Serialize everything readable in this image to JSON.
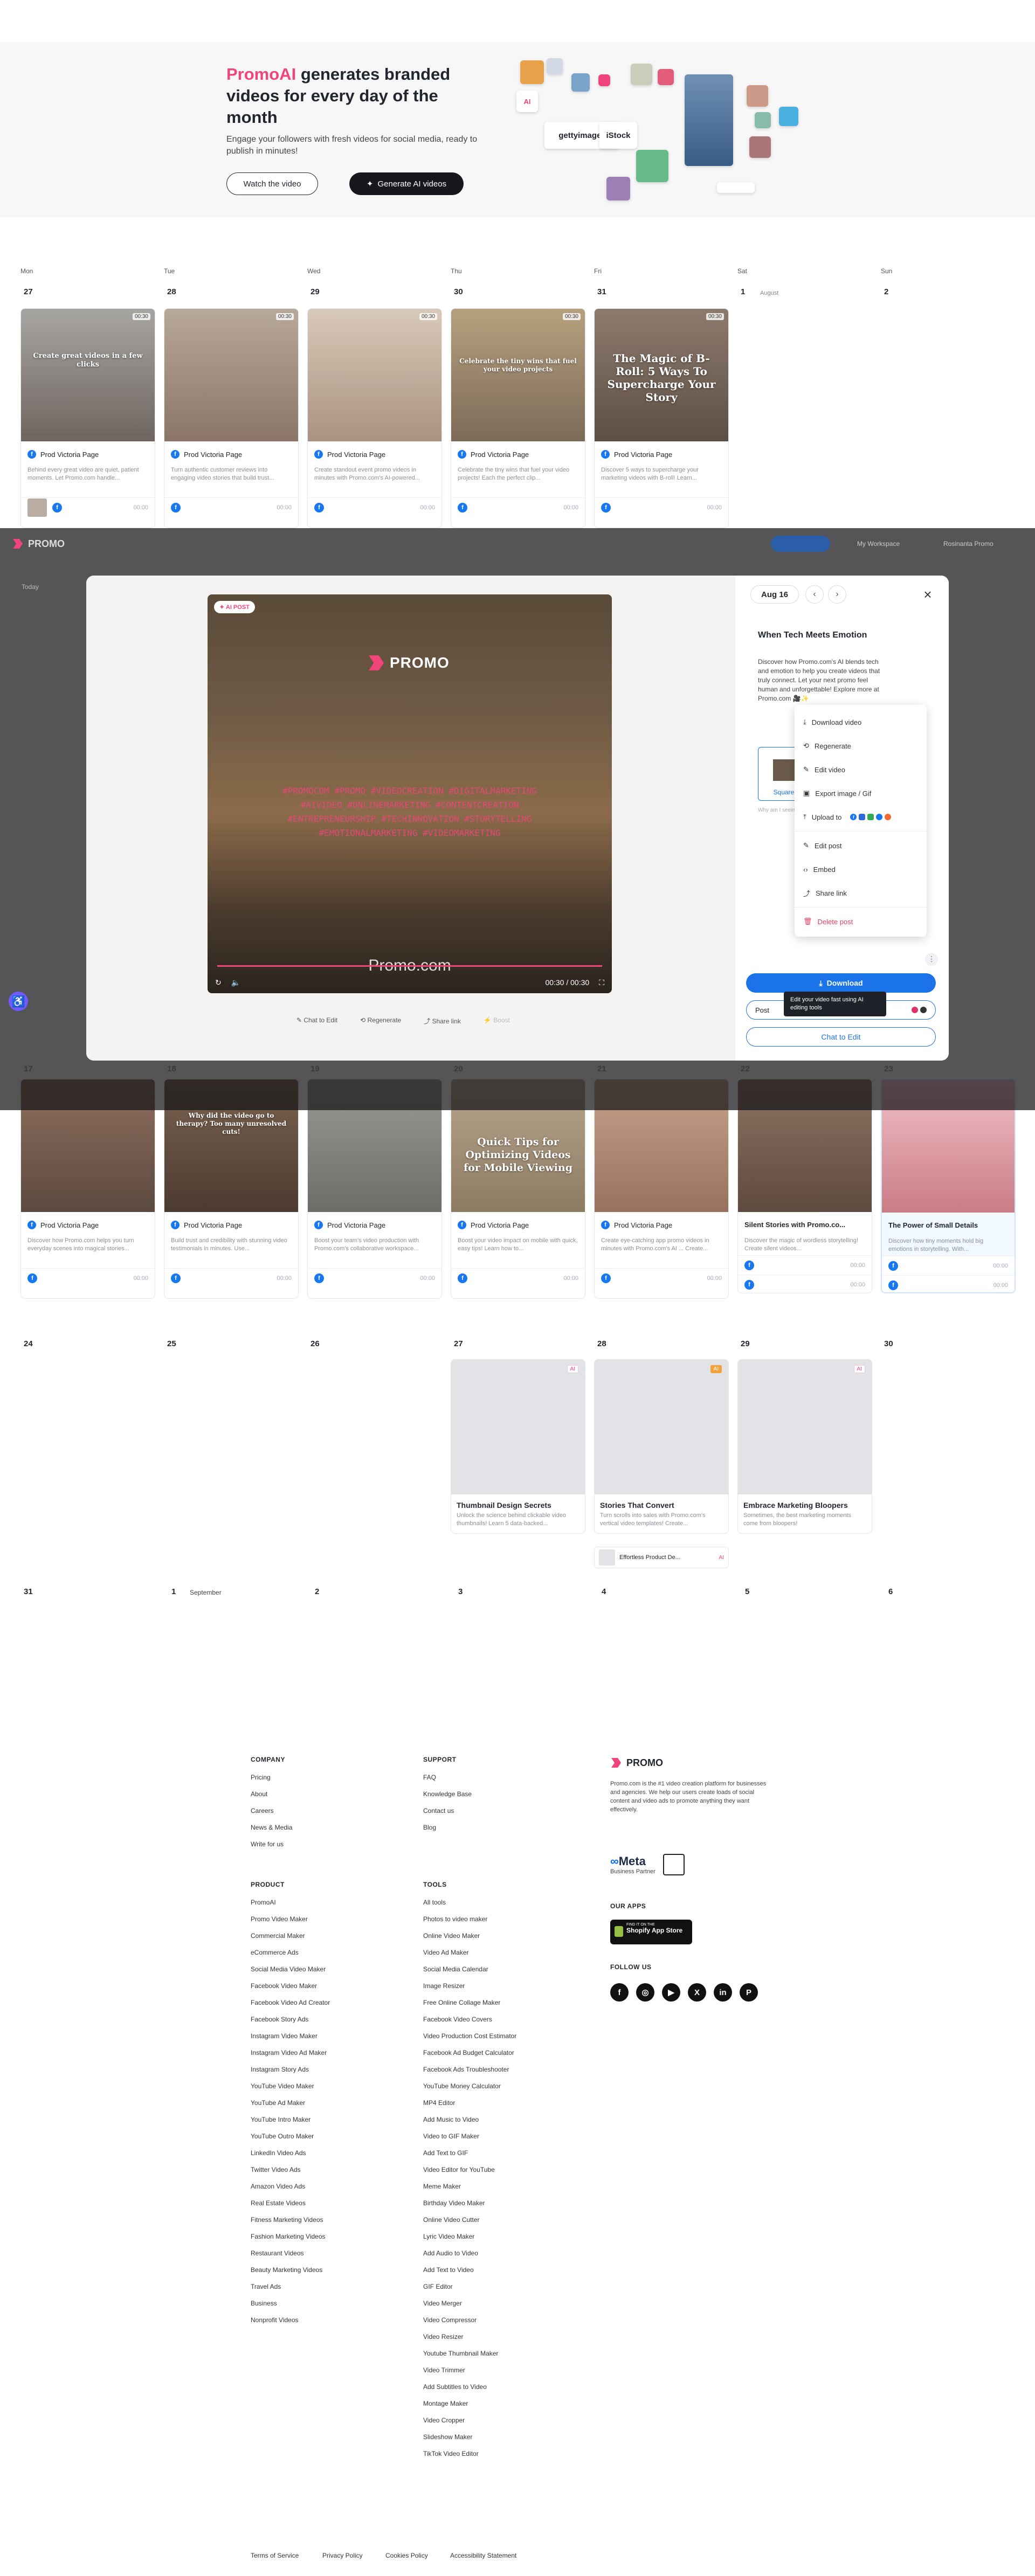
{
  "hero": {
    "brand": "PromoAI",
    "title_rest": "generates branded videos for every day of the month",
    "subtitle": "Engage your followers with fresh videos for social media, ready to publish in minutes!",
    "watch_label": "Watch the video",
    "generate_label": "Generate AI videos",
    "stock_labels": [
      "gettyimages",
      "iStock"
    ]
  },
  "calendar": {
    "day_names": [
      "Mon",
      "Tue",
      "Wed",
      "Thu",
      "Fri",
      "Sat",
      "Sun"
    ],
    "week1_dates": [
      "27",
      "28",
      "29",
      "30",
      "31",
      "1",
      "2"
    ],
    "week1_extra": "August",
    "week1_cards": [
      {
        "page": "Prod Victoria Page",
        "desc": "Behind every great video are quiet, patient moments. Let Promo.com handle...",
        "title": "Create great videos in a few clicks",
        "time": "00:00",
        "dur": "00:30"
      },
      {
        "page": "Prod Victoria Page",
        "desc": "Turn authentic customer reviews into engaging video stories that build trust...",
        "title": "",
        "time": "00:00",
        "dur": "00:30"
      },
      {
        "page": "Prod Victoria Page",
        "desc": "Create standout event promo videos in minutes with Promo.com's AI-powered...",
        "title": "",
        "time": "00:00",
        "dur": "00:30"
      },
      {
        "page": "Prod Victoria Page",
        "desc": "Celebrate the tiny wins that fuel your video projects! Each the perfect clip...",
        "title": "Celebrate the tiny wins that fuel your video projects",
        "time": "00:00",
        "dur": "00:30"
      },
      {
        "page": "Prod Victoria Page",
        "desc": "Discover 5 ways to supercharge your marketing videos with B-roll! Learn...",
        "title": "The Magic of B-Roll: 5 Ways To Supercharge Your Story",
        "time": "00:00",
        "dur": "00:30"
      }
    ],
    "week3_dates": [
      "17",
      "18",
      "19",
      "20",
      "21",
      "22",
      "23"
    ],
    "week3_cards": [
      {
        "page": "Prod Victoria Page",
        "desc": "Discover how Promo.com helps you turn everyday scenes into magical stories...",
        "title": "",
        "time": "00:00"
      },
      {
        "page": "Prod Victoria Page",
        "desc": "Build trust and credibility with stunning video testimonials in minutes. Use...",
        "title": "Why did the video go to therapy? Too many unresolved cuts!",
        "time": "00:00"
      },
      {
        "page": "Prod Victoria Page",
        "desc": "Boost your team's video production with Promo.com's collaborative workspace...",
        "title": "",
        "time": "00:00"
      },
      {
        "page": "Prod Victoria Page",
        "desc": "Boost your video impact on mobile with quick, easy tips! Learn how to...",
        "title": "Quick Tips for Optimizing Videos for Mobile Viewing",
        "time": "00:00"
      },
      {
        "page": "Prod Victoria Page",
        "desc": "Create eye-catching app promo videos in minutes with Promo.com's AI ... Create...",
        "title": "",
        "time": "00:00"
      },
      {
        "page": "Silent Stories with Promo.co...",
        "desc": "Discover the magic of wordless storytelling! Create silent videos...",
        "title": "",
        "time": "00:00"
      },
      {
        "page": "The Power of Small Details",
        "desc": "Discover how tiny moments hold big emotions in storytelling. With...",
        "title": "",
        "time": "00:00"
      }
    ],
    "week4_dates": [
      "24",
      "25",
      "26",
      "27",
      "28",
      "29",
      "30"
    ],
    "week4_cards": [
      {
        "title": "Thumbnail Design Secrets",
        "desc": "Unlock the science behind clickable video thumbnails! Learn 5 data-backed...",
        "tag": "AI"
      },
      {
        "title": "Stories That Convert",
        "desc": "Turn scrolls into sales with Promo.com's vertical video templates! Create...",
        "tag": "AI"
      },
      {
        "title": "Embrace Marketing Bloopers",
        "desc": "Sometimes, the best marketing moments come from bloopers!",
        "tag": "AI"
      }
    ],
    "week4_extra_label": "Effortless Product De...",
    "week5_dates": [
      "31",
      "1",
      "2",
      "3",
      "4",
      "5",
      "6"
    ],
    "week5_month": "September"
  },
  "overlay": {
    "app_name": "PROMO",
    "workspace": "My Workspace",
    "user": "Rosinanta Promo",
    "tab_label": "Today"
  },
  "modal": {
    "ai_badge": "AI POST",
    "video_logo": "PROMO",
    "video_tags": "#PROMOCOM #PROMO #VIDEOCREATION #DIGITALMARKETING #AIVIDEO #ONLINEMARKETING #CONTENTCREATION #ENTREPRENEURSHIP #TECHINNOVATION #STORYTELLING #EMOTIONALMARKETING #VIDEOMARKETING",
    "video_site": "Promo.com",
    "video_time": "00:30 / 00:30",
    "actions": [
      "Chat to Edit",
      "Regenerate",
      "Share link",
      "Boost"
    ],
    "date": "Aug 16",
    "post_title": "When Tech Meets Emotion",
    "post_body": "Discover how Promo.com's AI blends tech and emotion to help you create videos that truly connect. Let your next promo feel human and unforgettable! Explore more at Promo.com 🎥✨",
    "format_label": "Square",
    "why_label": "Why am I seeing this?",
    "menu": {
      "download": "Download video",
      "regenerate": "Regenerate",
      "edit": "Edit video",
      "export": "Export image / Gif",
      "upload": "Upload to",
      "edit_post": "Edit post",
      "embed": "Embed",
      "share": "Share link",
      "delete": "Delete post"
    },
    "download_label": "Download",
    "post_label": "Post",
    "tooltip": "Edit your video fast using AI editing tools",
    "chat_label": "Chat to Edit"
  },
  "footer": {
    "company_heading": "COMPANY",
    "company": [
      "Pricing",
      "About",
      "Careers",
      "News & Media",
      "Write for us"
    ],
    "support_heading": "SUPPORT",
    "support": [
      "FAQ",
      "Knowledge Base",
      "Contact us",
      "Blog"
    ],
    "product_heading": "PRODUCT",
    "product": [
      "PromoAI",
      "Promo Video Maker",
      "Commercial Maker",
      "eCommerce Ads",
      "Social Media Video Maker",
      "Facebook Video Maker",
      "Facebook Video Ad Creator",
      "Facebook Story Ads",
      "Instagram Video Maker",
      "Instagram Video Ad Maker",
      "Instagram Story Ads",
      "YouTube Video Maker",
      "YouTube Ad Maker",
      "YouTube Intro Maker",
      "YouTube Outro Maker",
      "LinkedIn Video Ads",
      "Twitter Video Ads",
      "Amazon Video Ads",
      "Real Estate Videos",
      "Fitness Marketing Videos",
      "Fashion Marketing Videos",
      "Restaurant Videos",
      "Beauty Marketing Videos",
      "Travel Ads",
      "Business",
      "Nonprofit Videos"
    ],
    "tools_heading": "TOOLS",
    "tools": [
      "All tools",
      "Photos to video maker",
      "Online Video Maker",
      "Video Ad Maker",
      "Social Media Calendar",
      "Image Resizer",
      "Free Online Collage Maker",
      "Facebook Video Covers",
      "Video Production Cost Estimator",
      "Facebook Ad Budget Calculator",
      "Facebook Ads Troubleshooter",
      "YouTube Money Calculator",
      "MP4 Editor",
      "Add Music to Video",
      "Video to GIF Maker",
      "Add Text to GIF",
      "Video Editor for YouTube",
      "Meme Maker",
      "Birthday Video Maker",
      "Online Video Cutter",
      "Lyric Video Maker",
      "Add Audio to Video",
      "Add Text to Video",
      "GIF Editor",
      "Video Merger",
      "Video Compressor",
      "Video Resizer",
      "Youtube Thumbnail Maker",
      "Video Trimmer",
      "Add Subtitles to Video",
      "Montage Maker",
      "Video Cropper",
      "Slideshow Maker",
      "TikTok Video Editor"
    ],
    "logo": "PROMO",
    "about": "Promo.com is the #1 video creation platform for businesses and agencies. We help our users create loads of social content and video ads to promote anything they want effectively.",
    "meta_name": "Meta",
    "meta_sub": "Business Partner",
    "apps_heading": "OUR APPS",
    "shopify_small": "FIND IT ON THE",
    "shopify_big": "Shopify App Store",
    "follow_heading": "FOLLOW US",
    "socials": [
      "f",
      "◎",
      "▶",
      "X",
      "in",
      "P"
    ],
    "legal": [
      "Terms of Service",
      "Privacy Policy",
      "Cookies Policy",
      "Accessibility Statement"
    ]
  }
}
